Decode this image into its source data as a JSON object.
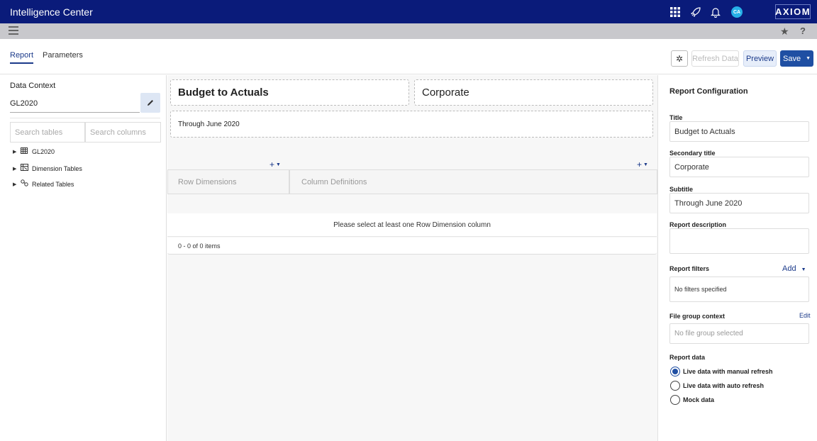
{
  "app": {
    "title": "Intelligence Center",
    "brand": "AXIOM",
    "avatar_initials": "CA"
  },
  "topbar_icons": [
    "grid-icon",
    "rocket-icon",
    "bell-icon"
  ],
  "subbar": {
    "star": "★",
    "help": "?"
  },
  "tabs": [
    {
      "label": "Report",
      "active": true
    },
    {
      "label": "Parameters",
      "active": false
    }
  ],
  "toolbar": {
    "gear": "✲",
    "refresh_label": "Refresh Data",
    "preview_label": "Preview",
    "save_label": "Save",
    "save_arrow": "▼"
  },
  "left_panel": {
    "data_context_label": "Data Context",
    "data_context_value": "GL2020",
    "search_tables_placeholder": "Search tables",
    "search_columns_placeholder": "Search columns",
    "tree": [
      {
        "label": "GL2020",
        "icon": "table-icon"
      },
      {
        "label": "Dimension Tables",
        "icon": "dimension-table-icon"
      },
      {
        "label": "Related Tables",
        "icon": "link-icon"
      }
    ]
  },
  "report": {
    "title": "Budget to Actuals",
    "secondary_title": "Corporate",
    "subtitle": "Through June 2020",
    "row_dimensions_label": "Row Dimensions",
    "column_definitions_label": "Column Definitions",
    "empty_message": "Please select at least one Row Dimension column",
    "pager_text": "0 - 0 of 0 items"
  },
  "config": {
    "heading": "Report Configuration",
    "title_label": "Title",
    "title_value": "Budget to Actuals",
    "secondary_title_label": "Secondary title",
    "secondary_title_value": "Corporate",
    "subtitle_label": "Subtitle",
    "subtitle_value": "Through June 2020",
    "description_label": "Report description",
    "description_value": "",
    "filters_label": "Report filters",
    "filters_add": "Add",
    "filters_empty": "No filters specified",
    "file_group_label": "File group context",
    "file_group_edit": "Edit",
    "file_group_placeholder": "No file group selected",
    "report_data_label": "Report data",
    "report_data_options": [
      {
        "label": "Live data with manual refresh",
        "checked": true
      },
      {
        "label": "Live data with auto refresh",
        "checked": false
      },
      {
        "label": "Mock data",
        "checked": false
      }
    ]
  }
}
